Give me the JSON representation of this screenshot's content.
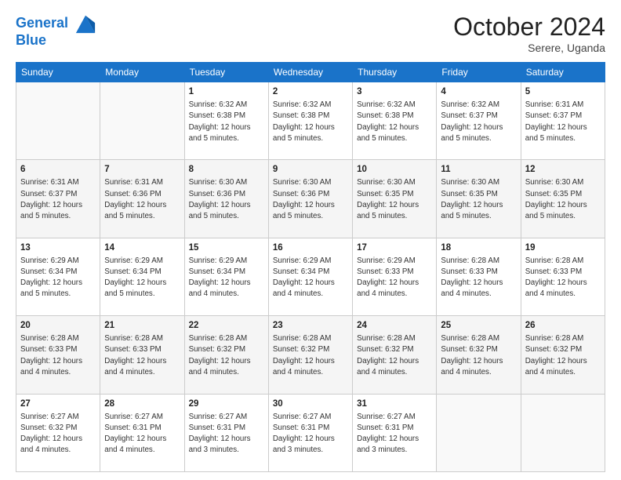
{
  "header": {
    "logo_line1": "General",
    "logo_line2": "Blue",
    "month_title": "October 2024",
    "location": "Serere, Uganda"
  },
  "days_of_week": [
    "Sunday",
    "Monday",
    "Tuesday",
    "Wednesday",
    "Thursday",
    "Friday",
    "Saturday"
  ],
  "weeks": [
    [
      {
        "day": "",
        "info": ""
      },
      {
        "day": "",
        "info": ""
      },
      {
        "day": "1",
        "info": "Sunrise: 6:32 AM\nSunset: 6:38 PM\nDaylight: 12 hours and 5 minutes."
      },
      {
        "day": "2",
        "info": "Sunrise: 6:32 AM\nSunset: 6:38 PM\nDaylight: 12 hours and 5 minutes."
      },
      {
        "day": "3",
        "info": "Sunrise: 6:32 AM\nSunset: 6:38 PM\nDaylight: 12 hours and 5 minutes."
      },
      {
        "day": "4",
        "info": "Sunrise: 6:32 AM\nSunset: 6:37 PM\nDaylight: 12 hours and 5 minutes."
      },
      {
        "day": "5",
        "info": "Sunrise: 6:31 AM\nSunset: 6:37 PM\nDaylight: 12 hours and 5 minutes."
      }
    ],
    [
      {
        "day": "6",
        "info": "Sunrise: 6:31 AM\nSunset: 6:37 PM\nDaylight: 12 hours and 5 minutes."
      },
      {
        "day": "7",
        "info": "Sunrise: 6:31 AM\nSunset: 6:36 PM\nDaylight: 12 hours and 5 minutes."
      },
      {
        "day": "8",
        "info": "Sunrise: 6:30 AM\nSunset: 6:36 PM\nDaylight: 12 hours and 5 minutes."
      },
      {
        "day": "9",
        "info": "Sunrise: 6:30 AM\nSunset: 6:36 PM\nDaylight: 12 hours and 5 minutes."
      },
      {
        "day": "10",
        "info": "Sunrise: 6:30 AM\nSunset: 6:35 PM\nDaylight: 12 hours and 5 minutes."
      },
      {
        "day": "11",
        "info": "Sunrise: 6:30 AM\nSunset: 6:35 PM\nDaylight: 12 hours and 5 minutes."
      },
      {
        "day": "12",
        "info": "Sunrise: 6:30 AM\nSunset: 6:35 PM\nDaylight: 12 hours and 5 minutes."
      }
    ],
    [
      {
        "day": "13",
        "info": "Sunrise: 6:29 AM\nSunset: 6:34 PM\nDaylight: 12 hours and 5 minutes."
      },
      {
        "day": "14",
        "info": "Sunrise: 6:29 AM\nSunset: 6:34 PM\nDaylight: 12 hours and 5 minutes."
      },
      {
        "day": "15",
        "info": "Sunrise: 6:29 AM\nSunset: 6:34 PM\nDaylight: 12 hours and 4 minutes."
      },
      {
        "day": "16",
        "info": "Sunrise: 6:29 AM\nSunset: 6:34 PM\nDaylight: 12 hours and 4 minutes."
      },
      {
        "day": "17",
        "info": "Sunrise: 6:29 AM\nSunset: 6:33 PM\nDaylight: 12 hours and 4 minutes."
      },
      {
        "day": "18",
        "info": "Sunrise: 6:28 AM\nSunset: 6:33 PM\nDaylight: 12 hours and 4 minutes."
      },
      {
        "day": "19",
        "info": "Sunrise: 6:28 AM\nSunset: 6:33 PM\nDaylight: 12 hours and 4 minutes."
      }
    ],
    [
      {
        "day": "20",
        "info": "Sunrise: 6:28 AM\nSunset: 6:33 PM\nDaylight: 12 hours and 4 minutes."
      },
      {
        "day": "21",
        "info": "Sunrise: 6:28 AM\nSunset: 6:33 PM\nDaylight: 12 hours and 4 minutes."
      },
      {
        "day": "22",
        "info": "Sunrise: 6:28 AM\nSunset: 6:32 PM\nDaylight: 12 hours and 4 minutes."
      },
      {
        "day": "23",
        "info": "Sunrise: 6:28 AM\nSunset: 6:32 PM\nDaylight: 12 hours and 4 minutes."
      },
      {
        "day": "24",
        "info": "Sunrise: 6:28 AM\nSunset: 6:32 PM\nDaylight: 12 hours and 4 minutes."
      },
      {
        "day": "25",
        "info": "Sunrise: 6:28 AM\nSunset: 6:32 PM\nDaylight: 12 hours and 4 minutes."
      },
      {
        "day": "26",
        "info": "Sunrise: 6:28 AM\nSunset: 6:32 PM\nDaylight: 12 hours and 4 minutes."
      }
    ],
    [
      {
        "day": "27",
        "info": "Sunrise: 6:27 AM\nSunset: 6:32 PM\nDaylight: 12 hours and 4 minutes."
      },
      {
        "day": "28",
        "info": "Sunrise: 6:27 AM\nSunset: 6:31 PM\nDaylight: 12 hours and 4 minutes."
      },
      {
        "day": "29",
        "info": "Sunrise: 6:27 AM\nSunset: 6:31 PM\nDaylight: 12 hours and 3 minutes."
      },
      {
        "day": "30",
        "info": "Sunrise: 6:27 AM\nSunset: 6:31 PM\nDaylight: 12 hours and 3 minutes."
      },
      {
        "day": "31",
        "info": "Sunrise: 6:27 AM\nSunset: 6:31 PM\nDaylight: 12 hours and 3 minutes."
      },
      {
        "day": "",
        "info": ""
      },
      {
        "day": "",
        "info": ""
      }
    ]
  ]
}
